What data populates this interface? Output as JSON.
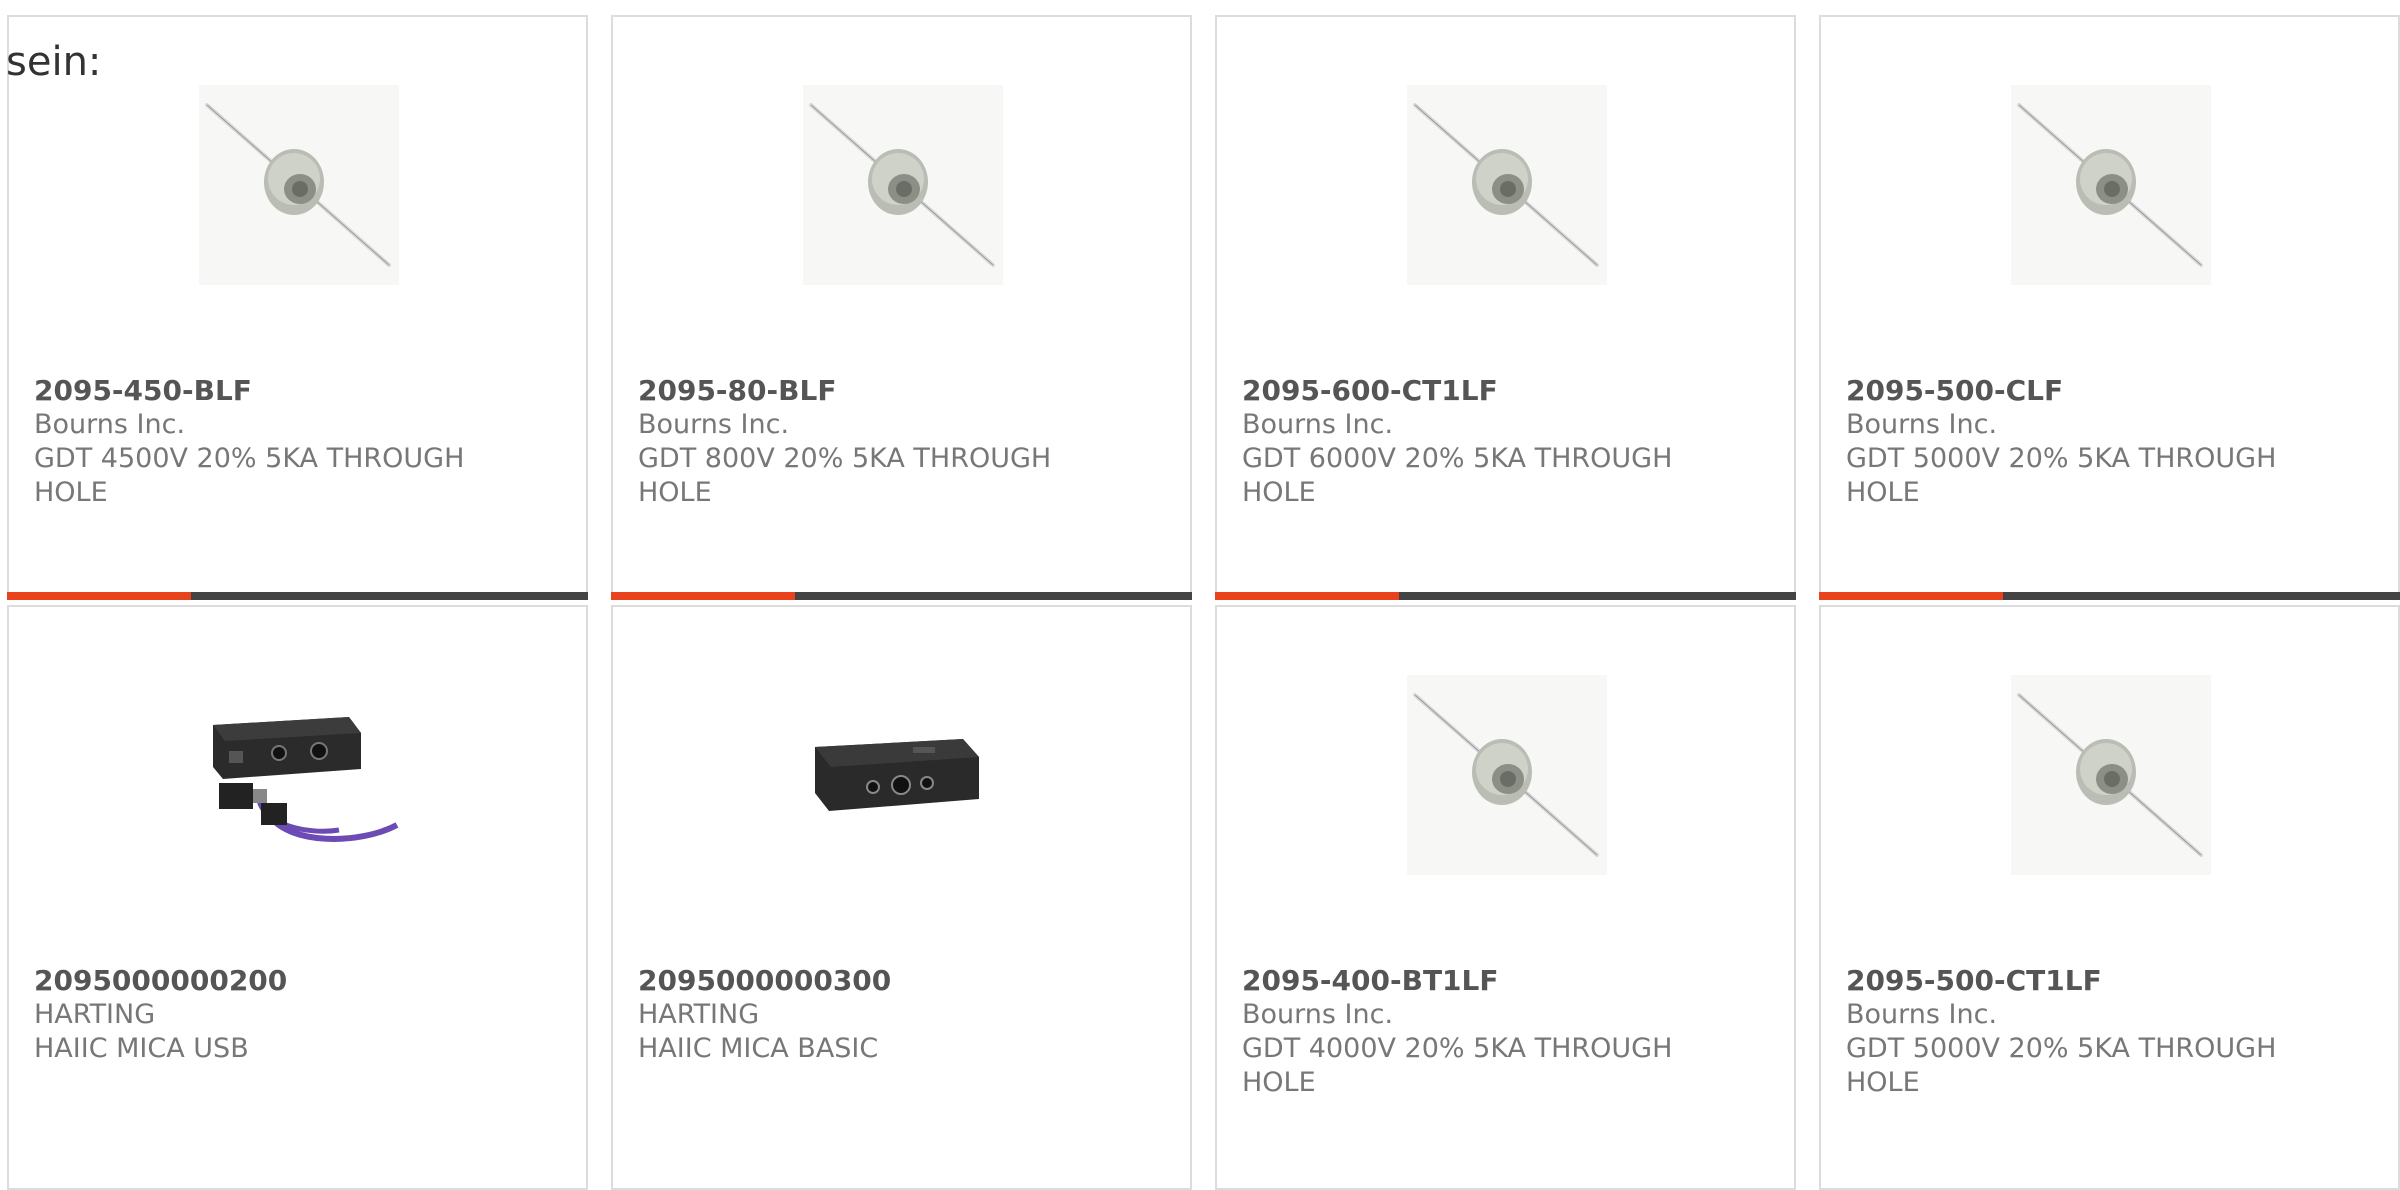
{
  "intro_text": "sein:",
  "products": [
    {
      "part_number": "2095-450-BLF",
      "manufacturer": "Bourns Inc.",
      "description": "GDT 4500V 20% 5KA THROUGH HOLE",
      "image_icon": "gas-discharge-tube-icon",
      "image_alt": "2095-450-BLF"
    },
    {
      "part_number": "2095-80-BLF",
      "manufacturer": "Bourns Inc.",
      "description": "GDT 800V 20% 5KA THROUGH HOLE",
      "image_icon": "gas-discharge-tube-icon",
      "image_alt": "2095-80-BLF"
    },
    {
      "part_number": "2095-600-CT1LF",
      "manufacturer": "Bourns Inc.",
      "description": "GDT 6000V 20% 5KA THROUGH HOLE",
      "image_icon": "gas-discharge-tube-icon",
      "image_alt": "2095-600-CT1LF"
    },
    {
      "part_number": "2095-500-CLF",
      "manufacturer": "Bourns Inc.",
      "description": "GDT 5000V 20% 5KA THROUGH HOLE",
      "image_icon": "gas-discharge-tube-icon",
      "image_alt": "2095-500-CLF"
    },
    {
      "part_number": "2095000000200",
      "manufacturer": "HARTING",
      "description": "HAIIC MICA USB",
      "image_icon": "mica-usb-module-icon",
      "image_alt": "2095000000200"
    },
    {
      "part_number": "2095000000300",
      "manufacturer": "HARTING",
      "description": "HAIIC MICA BASIC",
      "image_icon": "mica-basic-module-icon",
      "image_alt": "2095000000300"
    },
    {
      "part_number": "2095-400-BT1LF",
      "manufacturer": "Bourns Inc.",
      "description": "GDT 4000V 20% 5KA THROUGH HOLE",
      "image_icon": "gas-discharge-tube-icon",
      "image_alt": "2095-400-BT1LF"
    },
    {
      "part_number": "2095-500-CT1LF",
      "manufacturer": "Bourns Inc.",
      "description": "GDT 5000V 20% 5KA THROUGH HOLE",
      "image_icon": "gas-discharge-tube-icon",
      "image_alt": "2095-500-CT1LF"
    }
  ],
  "colors": {
    "accent": "#e8431c",
    "bar": "#444444",
    "card_border": "#dcdcdc",
    "part_number": "#555555",
    "meta_text": "#777777"
  }
}
